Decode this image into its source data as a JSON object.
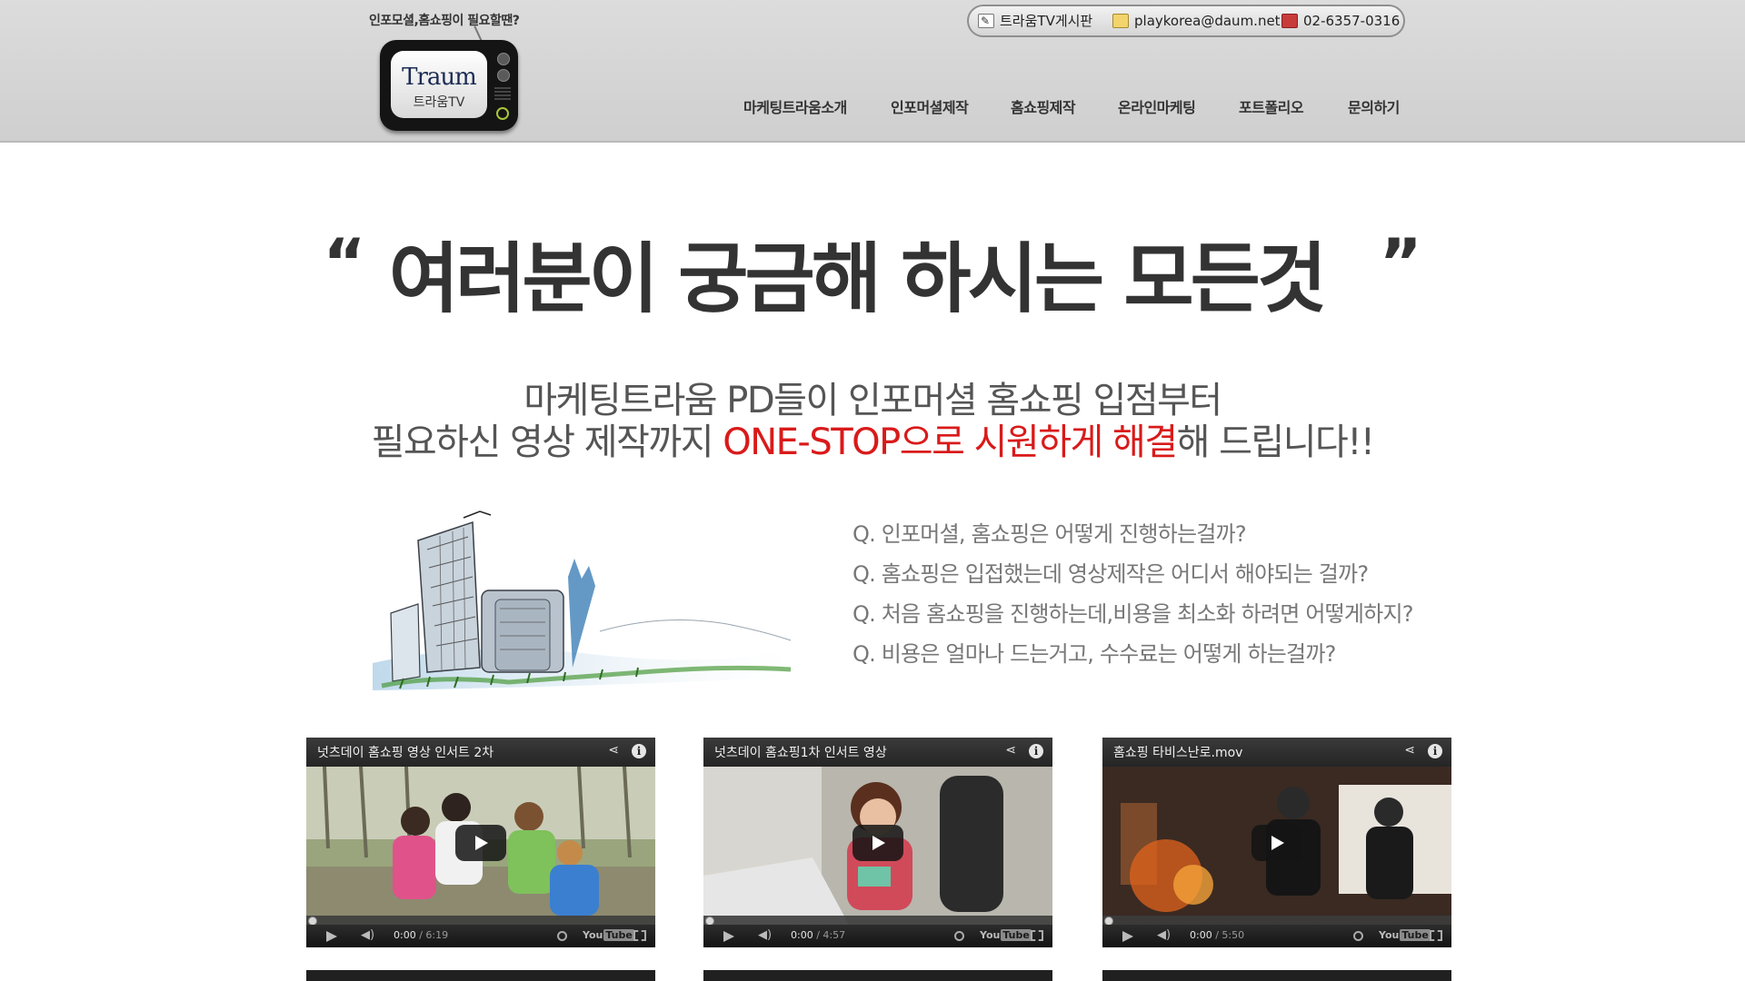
{
  "header": {
    "tagline": "인포모셜,홈쇼핑이 필요할땐?",
    "logo": {
      "text": "Traum",
      "sub": "트라움TV"
    },
    "contacts": [
      {
        "icon": "board-icon",
        "label": "트라움TV게시판"
      },
      {
        "icon": "mail-icon",
        "label": "playkorea@daum.net"
      },
      {
        "icon": "phone-icon",
        "label": "02-6357-0316"
      }
    ],
    "nav": [
      {
        "label": "마케팅트라움소개"
      },
      {
        "label": "인포머셜제작"
      },
      {
        "label": "홈쇼핑제작"
      },
      {
        "label": "온라인마케팅"
      },
      {
        "label": "포트폴리오"
      },
      {
        "label": "문의하기"
      }
    ]
  },
  "hero": {
    "quote_open": "“",
    "headline": "여러분이 궁금해 하시는 모든것",
    "quote_close": "”",
    "sub_line1": "마케팅트라움 PD들이 인포머셜 홈쇼핑 입점부터",
    "sub_line2_a": "필요하신 영상 제작까지 ",
    "sub_line2_highlight": "ONE-STOP으로 시원하게 해결",
    "sub_line2_b": "해 드립니다!!"
  },
  "questions": [
    "Q. 인포머셜, 홈쇼핑은 어떻게 진행하는걸까?",
    "Q. 홈쇼핑은 입접했는데 영상제작은 어디서 해야되는 걸까?",
    "Q. 처음 홈쇼핑을 진행하는데,비용을 최소화 하려면 어떻게하지?",
    "Q. 비용은 얼마나 드는거고, 수수료는 어떻게 하는걸까?"
  ],
  "videos": [
    {
      "title": "넛츠데이 홈쇼핑 영상 인서트 2차",
      "time": "0:00",
      "duration": "/ 6:19"
    },
    {
      "title": "넛츠데이 홈쇼핑1차 인서트 영상",
      "time": "0:00",
      "duration": "/ 4:57"
    },
    {
      "title": "홈쇼핑 타비스난로.mov",
      "time": "0:00",
      "duration": "/ 5:50"
    }
  ],
  "colors": {
    "highlight": "#d91a1a",
    "header_bg": "#d6d6d6"
  }
}
